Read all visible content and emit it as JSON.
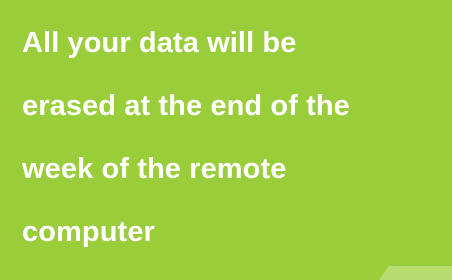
{
  "notice": {
    "lines": [
      "All your data will be",
      "erased at the end of the",
      "week of the remote",
      "computer"
    ],
    "background_color": "#9acd3a",
    "text_color": "#ffffff"
  }
}
